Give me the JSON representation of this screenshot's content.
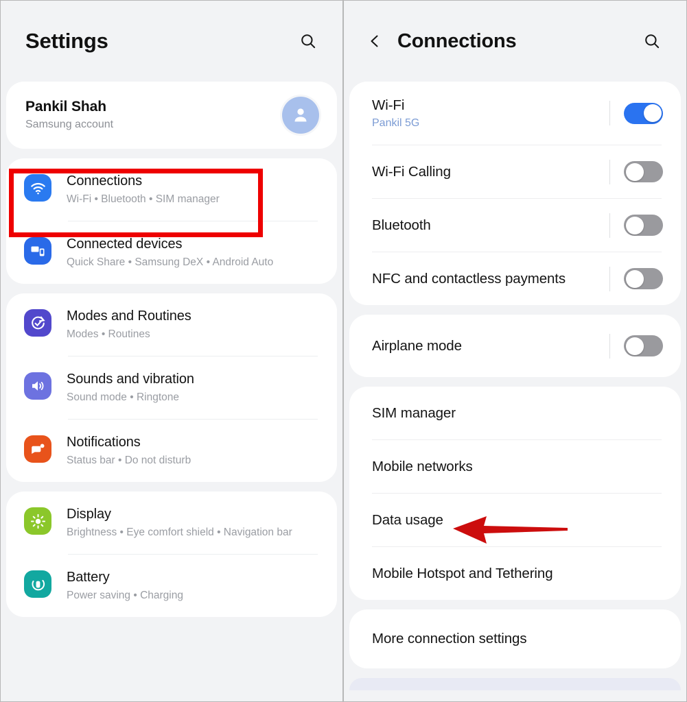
{
  "left_panel": {
    "header": {
      "title": "Settings",
      "search_icon": "search-icon"
    },
    "profile": {
      "name": "Pankil Shah",
      "subtitle": "Samsung account",
      "avatar_icon": "person-icon"
    },
    "groups": [
      {
        "items": [
          {
            "title": "Connections",
            "subtitle": "Wi-Fi • Bluetooth • SIM manager",
            "icon": "wifi-icon",
            "icon_color": "#2a7af0",
            "highlighted": true
          },
          {
            "title": "Connected devices",
            "subtitle": "Quick Share • Samsung DeX • Android Auto",
            "icon": "devices-icon",
            "icon_color": "#2a6ae8",
            "highlighted": false
          }
        ]
      },
      {
        "items": [
          {
            "title": "Modes and Routines",
            "subtitle": "Modes • Routines",
            "icon": "modes-icon",
            "icon_color": "#5248cc",
            "highlighted": false
          },
          {
            "title": "Sounds and vibration",
            "subtitle": "Sound mode • Ringtone",
            "icon": "sound-icon",
            "icon_color": "#6d72e0",
            "highlighted": false
          },
          {
            "title": "Notifications",
            "subtitle": "Status bar • Do not disturb",
            "icon": "notifications-icon",
            "icon_color": "#e8531b",
            "highlighted": false
          }
        ]
      },
      {
        "items": [
          {
            "title": "Display",
            "subtitle": "Brightness • Eye comfort shield • Navigation bar",
            "icon": "brightness-icon",
            "icon_color": "#8bc72a",
            "highlighted": false
          },
          {
            "title": "Battery",
            "subtitle": "Power saving • Charging",
            "icon": "battery-icon",
            "icon_color": "#12a8a0",
            "highlighted": false
          }
        ]
      }
    ]
  },
  "right_panel": {
    "header": {
      "title": "Connections",
      "back_icon": "chevron-left-icon",
      "search_icon": "search-icon"
    },
    "groups": [
      {
        "rows": [
          {
            "title": "Wi-Fi",
            "subtitle": "Pankil 5G",
            "toggle": "on"
          },
          {
            "title": "Wi-Fi Calling",
            "subtitle": "",
            "toggle": "off"
          },
          {
            "title": "Bluetooth",
            "subtitle": "",
            "toggle": "off"
          },
          {
            "title": "NFC and contactless payments",
            "subtitle": "",
            "toggle": "off"
          }
        ]
      },
      {
        "rows": [
          {
            "title": "Airplane mode",
            "subtitle": "",
            "toggle": "off"
          }
        ]
      },
      {
        "rows": [
          {
            "title": "SIM manager",
            "subtitle": "",
            "toggle": "none"
          },
          {
            "title": "Mobile networks",
            "subtitle": "",
            "toggle": "none"
          },
          {
            "title": "Data usage",
            "subtitle": "",
            "toggle": "none",
            "annotated": true
          },
          {
            "title": "Mobile Hotspot and Tethering",
            "subtitle": "",
            "toggle": "none"
          }
        ]
      },
      {
        "rows": [
          {
            "title": "More connection settings",
            "subtitle": "",
            "toggle": "none"
          }
        ]
      }
    ]
  },
  "annotations": {
    "highlight_color": "#ee0000",
    "arrow_color": "#cc0d0d",
    "highlight_target": "Connections",
    "arrow_target": "Data usage"
  }
}
